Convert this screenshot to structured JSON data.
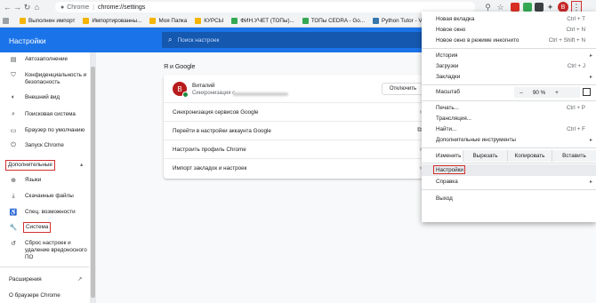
{
  "browser": {
    "url_host": "Chrome",
    "url": "chrome://settings",
    "avatar_letter": "В",
    "menu_dots": "⋮"
  },
  "bookmarks": [
    {
      "label": "Выполнен импорт",
      "icon": "folder-icon"
    },
    {
      "label": "Импортированны...",
      "icon": "folder-icon"
    },
    {
      "label": "Моя Папка",
      "icon": "folder-icon"
    },
    {
      "label": "КУРСЫ",
      "icon": "folder-icon"
    },
    {
      "label": "ФИН.УЧЕТ (ТОПы)...",
      "icon": "sheet-icon"
    },
    {
      "label": "ТОПы CEDRA - Go...",
      "icon": "sheet-icon"
    },
    {
      "label": "Python Tutor - Visu...",
      "icon": "python-icon"
    }
  ],
  "header": {
    "title": "Настройки",
    "search_placeholder": "Поиск настроек"
  },
  "sidebar": {
    "items": [
      {
        "label": "Автозаполнение",
        "icon": "autofill-icon",
        "glyph": "▤"
      },
      {
        "label": "Конфиденциальность и безопасность",
        "icon": "shield-icon",
        "glyph": "⛉"
      },
      {
        "label": "Внешний вид",
        "icon": "palette-icon",
        "glyph": "◐"
      },
      {
        "label": "Поисковая система",
        "icon": "search-icon",
        "glyph": "⌕"
      },
      {
        "label": "Браузер по умолчанию",
        "icon": "browser-icon",
        "glyph": "▭"
      },
      {
        "label": "Запуск Chrome",
        "icon": "power-icon",
        "glyph": "⏻"
      }
    ],
    "advanced_label": "Дополнительные",
    "advanced_glyph": "▴",
    "advanced_items": [
      {
        "label": "Языки",
        "icon": "globe-icon",
        "glyph": "⊕"
      },
      {
        "label": "Скачанные файлы",
        "icon": "download-icon",
        "glyph": "⤓"
      },
      {
        "label": "Спец. возможности",
        "icon": "accessibility-icon",
        "glyph": "♿"
      },
      {
        "label": "Система",
        "icon": "wrench-icon",
        "glyph": "🔧"
      },
      {
        "label": "Сброс настроек и удаление вредоносного ПО",
        "icon": "reset-icon",
        "glyph": "↺"
      }
    ],
    "extensions_label": "Расширения",
    "extensions_glyph": "↗",
    "about_label": "О браузере Chrome"
  },
  "main": {
    "section_title": "Я и Google",
    "profile": {
      "name": "Виталий",
      "sync_text": "Синхронизация с",
      "avatar_letter": "В",
      "signout_label": "Отключить"
    },
    "rows": [
      {
        "label": "Синхронизация сервисов Google",
        "glyph": "›"
      },
      {
        "label": "Перейти в настройки аккаунта Google",
        "glyph": "⧉"
      },
      {
        "label": "Настроить профиль Chrome",
        "glyph": "›"
      },
      {
        "label": "Импорт закладок и настроек",
        "glyph": "›"
      }
    ]
  },
  "menu": {
    "group1": [
      {
        "label": "Новая вкладка",
        "shortcut": "Ctrl + T"
      },
      {
        "label": "Новое окно",
        "shortcut": "Ctrl + N"
      },
      {
        "label": "Новое окно в режиме инкогнито",
        "shortcut": "Ctrl + Shift + N"
      }
    ],
    "group2": [
      {
        "label": "История",
        "shortcut": "",
        "sub": "▸"
      },
      {
        "label": "Загрузки",
        "shortcut": "Ctrl + J",
        "sub": ""
      },
      {
        "label": "Закладки",
        "shortcut": "",
        "sub": "▸"
      }
    ],
    "zoom": {
      "label": "Масштаб",
      "minus": "–",
      "value": "90 %",
      "plus": "+"
    },
    "group3": [
      {
        "label": "Печать...",
        "shortcut": "Ctrl + P",
        "sub": ""
      },
      {
        "label": "Трансляция...",
        "shortcut": "",
        "sub": ""
      },
      {
        "label": "Найти...",
        "shortcut": "Ctrl + F",
        "sub": ""
      },
      {
        "label": "Дополнительные инструменты",
        "shortcut": "",
        "sub": "▸"
      }
    ],
    "edit": {
      "label": "Изменить",
      "cut": "Вырезать",
      "copy": "Копировать",
      "paste": "Вставить"
    },
    "settings_label": "Настройки",
    "help_label": "Справка",
    "help_sub": "▸",
    "exit_label": "Выход"
  },
  "colors": {
    "accent": "#1a73e8",
    "highlight": "#d32f2f"
  }
}
